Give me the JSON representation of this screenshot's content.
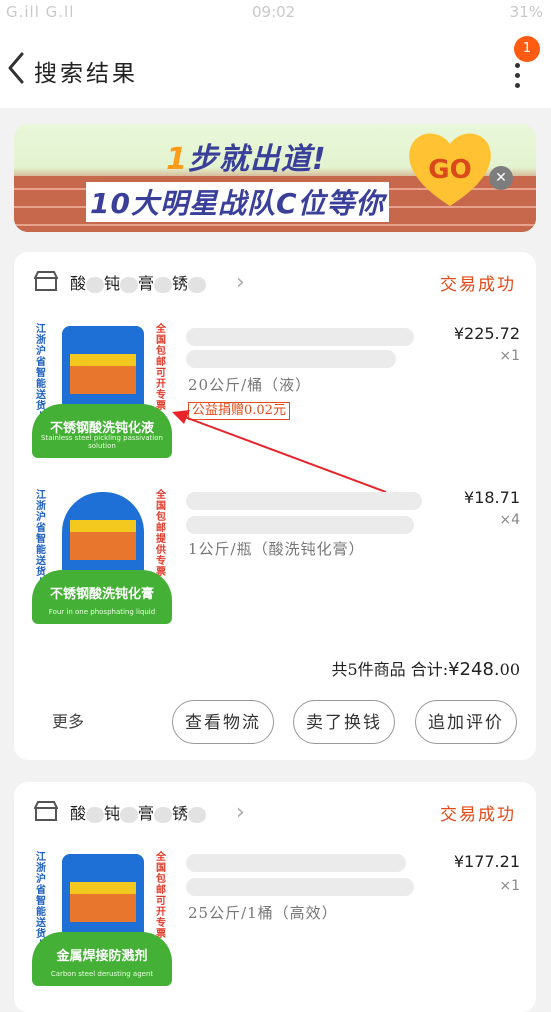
{
  "status_bar": {
    "left": "G.ill G.ll",
    "time": "09:02",
    "battery": "31%"
  },
  "header": {
    "title": "搜索结果",
    "badge_count": "1"
  },
  "banner": {
    "line1_num": "1",
    "line1_text": "步就出道!",
    "line2": "10大明星战队C位等你",
    "go_label": "GO"
  },
  "orders": [
    {
      "shop_name": [
        "酸",
        "钝",
        "膏",
        "锈"
      ],
      "status": "交易成功",
      "items": [
        {
          "price": "¥225.72",
          "qty": "×1",
          "spec": "20公斤/桶（液）",
          "charity": "公益捐赠0.02元",
          "img_title": "不锈钢酸洗钝化液",
          "img_sub": "Stainless steel pickling passivation solution",
          "img_side_left": "江浙沪省智能送货上门",
          "img_side_right": "全国包邮可开专票"
        },
        {
          "price": "¥18.71",
          "qty": "×4",
          "spec": "1公斤/瓶（酸洗钝化膏）",
          "img_title": "不锈钢酸洗钝化膏",
          "img_sub": "Four in one phosphating liquid",
          "img_side_left": "江浙沪省智能送货上门",
          "img_side_right": "全国包邮提供专票"
        }
      ],
      "summary": "共5件商品  合计:",
      "total_main": "¥248.",
      "total_dec": "00",
      "more_label": "更多",
      "buttons": [
        "查看物流",
        "卖了换钱",
        "追加评价"
      ]
    },
    {
      "shop_name": [
        "酸",
        "钝",
        "膏",
        "锈"
      ],
      "status": "交易成功",
      "items": [
        {
          "price": "¥177.21",
          "qty": "×1",
          "spec": "25公斤/1桶（高效）",
          "img_title": "金属焊接防溅剂",
          "img_sub": "Carbon steel derusting agent",
          "img_side_left": "江浙沪省智能送货上门",
          "img_side_right": "全国包邮可开专票"
        }
      ]
    }
  ],
  "colors": {
    "accent": "#e34a17",
    "badge": "#ff5b12",
    "product_green": "#44b035"
  }
}
